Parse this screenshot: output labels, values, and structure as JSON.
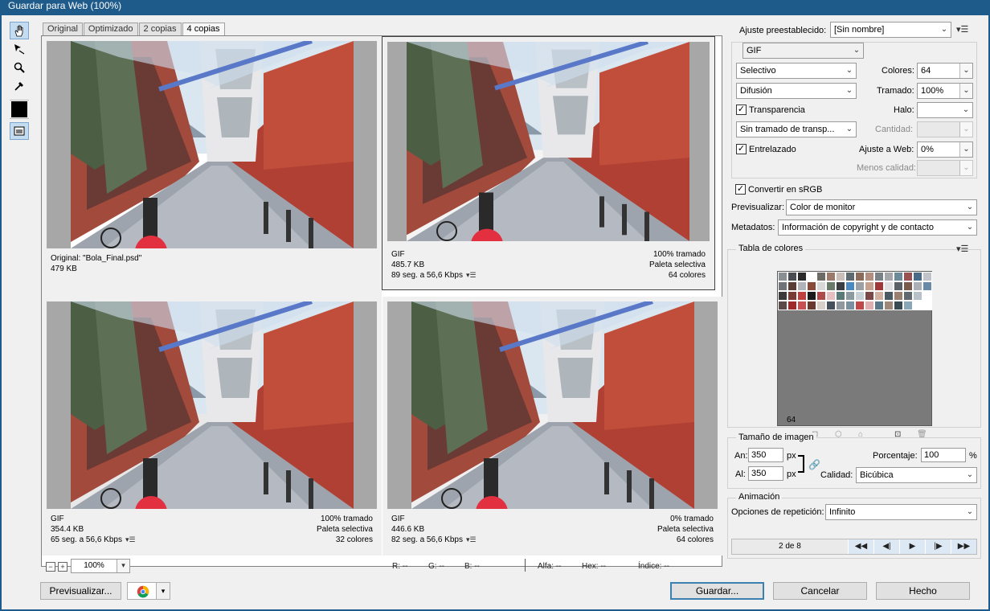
{
  "window": {
    "title": "Guardar para Web (100%)"
  },
  "tabs": [
    "Original",
    "Optimizado",
    "2 copias",
    "4 copias"
  ],
  "panes": [
    {
      "l1": "Original: \"Bola_Final.psd\"",
      "l2": "479 KB",
      "l3": "",
      "r1": "",
      "r2": "",
      "r3": "",
      "menu": false
    },
    {
      "l1": "GIF",
      "l2": "485.7 KB",
      "l3": "89 seg. a 56,6 Kbps",
      "r1": "100% tramado",
      "r2": "Paleta selectiva",
      "r3": "64 colores",
      "menu": true
    },
    {
      "l1": "GIF",
      "l2": "354.4 KB",
      "l3": "65 seg. a 56,6 Kbps",
      "r1": "100% tramado",
      "r2": "Paleta selectiva",
      "r3": "32 colores",
      "menu": true
    },
    {
      "l1": "GIF",
      "l2": "446.6 KB",
      "l3": "82 seg. a 56,6 Kbps",
      "r1": "0% tramado",
      "r2": "Paleta selectiva",
      "r3": "64 colores",
      "menu": true
    }
  ],
  "status": {
    "zoom": "100%",
    "r": "R: --",
    "g": "G: --",
    "b": "B: --",
    "alfa": "Alfa: --",
    "hex": "Hex: --",
    "indice": "Índice: --"
  },
  "buttons": {
    "preview": "Previsualizar...",
    "save": "Guardar...",
    "cancel": "Cancelar",
    "done": "Hecho"
  },
  "settings": {
    "preset_label": "Ajuste preestablecido:",
    "preset_value": "[Sin nombre]",
    "format": "GIF",
    "palette": "Selectivo",
    "colors_label": "Colores:",
    "colors_value": "64",
    "dither": "Difusión",
    "dither_amount_label": "Tramado:",
    "dither_amount": "100%",
    "transparency_label": "Transparencia",
    "transparency_checked": true,
    "matte_label": "Halo:",
    "matte_value": "",
    "transp_dither": "Sin tramado de transp...",
    "amount_label": "Cantidad:",
    "interlaced_label": "Entrelazado",
    "interlaced_checked": true,
    "websnap_label": "Ajuste a Web:",
    "websnap_value": "0%",
    "lossy_label": "Menos calidad:",
    "srgb_label": "Convertir en sRGB",
    "srgb_checked": true,
    "preview_label": "Previsualizar:",
    "preview_value": "Color de monitor",
    "metadata_label": "Metadatos:",
    "metadata_value": "Información de copyright y de contacto"
  },
  "color_table": {
    "title": "Tabla de colores",
    "count": "64",
    "colors": [
      "#8a8f94",
      "#4a4e52",
      "#2a2a2a",
      "#ffffff",
      "#6e6a66",
      "#9c7a6a",
      "#c9bfb8",
      "#5f6970",
      "#8d6b5b",
      "#b38f80",
      "#7a8288",
      "#a5a7ab",
      "#6b8a9a",
      "#9a5050",
      "#4a6a8a",
      "#c0c4c8",
      "#707478",
      "#5a3e36",
      "#b0b4b8",
      "#8a4a3a",
      "#d8d8d8",
      "#6a7a6a",
      "#3a3e42",
      "#4a8ac0",
      "#9aa0a6",
      "#c8a090",
      "#a03838",
      "#e0e0e0",
      "#5a6268",
      "#7a5a4a",
      "#aab0b6",
      "#6a8aaa",
      "#3a3a3a",
      "#783c34",
      "#c04040",
      "#1a1a1a",
      "#b04a4a",
      "#e6c0c0",
      "#5a7a7a",
      "#8a9aa0",
      "#c8d0d8",
      "#7a4848",
      "#d0b0a0",
      "#4a5a62",
      "#9a8070",
      "#606870",
      "#b8c0c8",
      "#ffffff",
      "#5a4a48",
      "#a0282a",
      "#c85050",
      "#6a3a30",
      "#d8d0c8",
      "#46505a",
      "#90989e",
      "#7890a0",
      "#c04848",
      "#e0b0b0",
      "#5a7888",
      "#a08878",
      "#3a4a52",
      "#88a8b8",
      "#ffffff",
      "#ffffff"
    ]
  },
  "image_size": {
    "title": "Tamaño de imagen",
    "width_label": "An:",
    "width_value": "350",
    "height_label": "Al:",
    "height_value": "350",
    "unit": "px",
    "percent_label": "Porcentaje:",
    "percent_value": "100",
    "percent_unit": "%",
    "quality_label": "Calidad:",
    "quality_value": "Bicúbica"
  },
  "animation": {
    "title": "Animación",
    "loop_label": "Opciones de repetición:",
    "loop_value": "Infinito",
    "frame": "2 de 8"
  }
}
